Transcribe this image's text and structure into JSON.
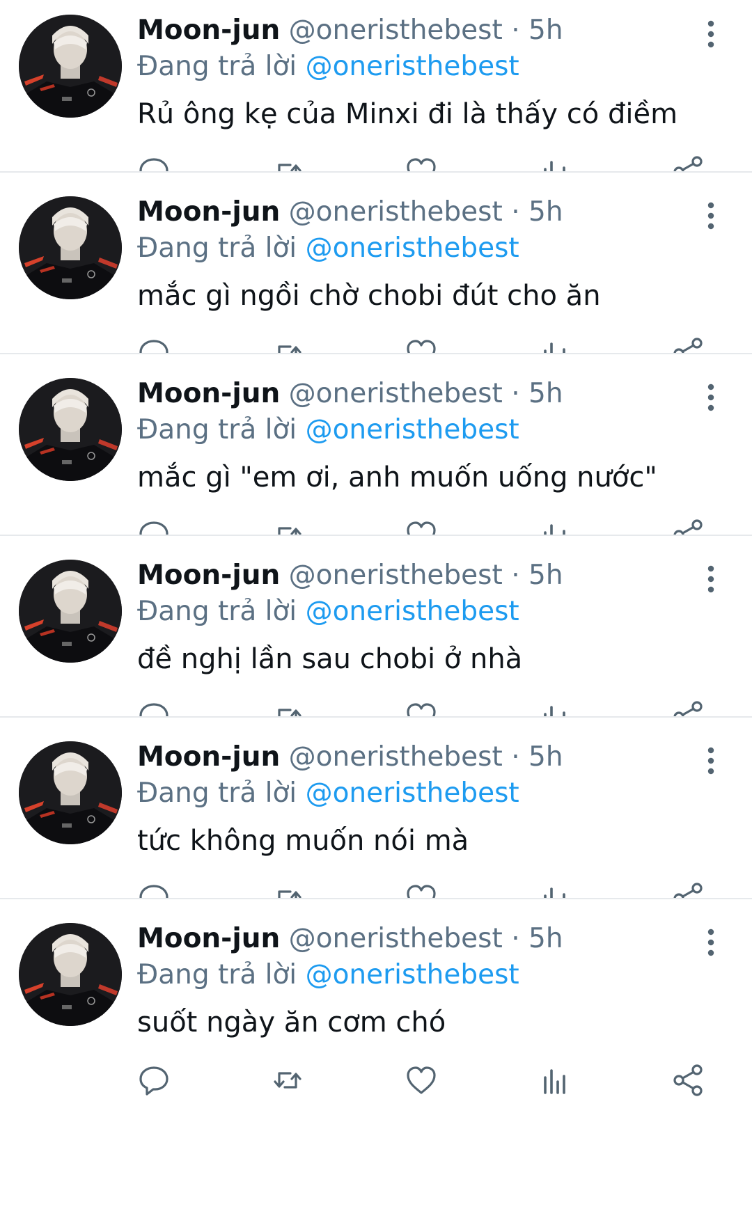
{
  "tweets": [
    {
      "name": "Moon-jun",
      "handle": "@oneristhebest",
      "separator": "·",
      "time": "5h",
      "reply_prefix": "Đang trả lời",
      "reply_to": "@oneristhebest",
      "text": "Rủ ông kẹ của Minxi đi là thấy có điềm"
    },
    {
      "name": "Moon-jun",
      "handle": "@oneristhebest",
      "separator": "·",
      "time": "5h",
      "reply_prefix": "Đang trả lời",
      "reply_to": "@oneristhebest",
      "text": "mắc gì ngồi chờ chobi đút cho ăn"
    },
    {
      "name": "Moon-jun",
      "handle": "@oneristhebest",
      "separator": "·",
      "time": "5h",
      "reply_prefix": "Đang trả lời",
      "reply_to": "@oneristhebest",
      "text": "mắc gì \"em ơi, anh muốn uống nước\""
    },
    {
      "name": "Moon-jun",
      "handle": "@oneristhebest",
      "separator": "·",
      "time": "5h",
      "reply_prefix": "Đang trả lời",
      "reply_to": "@oneristhebest",
      "text": "đề nghị lần sau chobi ở nhà"
    },
    {
      "name": "Moon-jun",
      "handle": "@oneristhebest",
      "separator": "·",
      "time": "5h",
      "reply_prefix": "Đang trả lời",
      "reply_to": "@oneristhebest",
      "text": "tức không muốn nói mà"
    },
    {
      "name": "Moon-jun",
      "handle": "@oneristhebest",
      "separator": "·",
      "time": "5h",
      "reply_prefix": "Đang trả lời",
      "reply_to": "@oneristhebest",
      "text": "suốt ngày ăn cơm chó"
    }
  ],
  "action_icons": [
    "reply-icon",
    "retweet-icon",
    "like-icon",
    "stats-icon",
    "share-icon"
  ],
  "menu_icon": "more-vertical-icon",
  "colors": {
    "name": "#0f1419",
    "secondary": "#5b7083",
    "link": "#1d9bf0",
    "icon": "#536471",
    "divider": "#e6e9ec"
  }
}
